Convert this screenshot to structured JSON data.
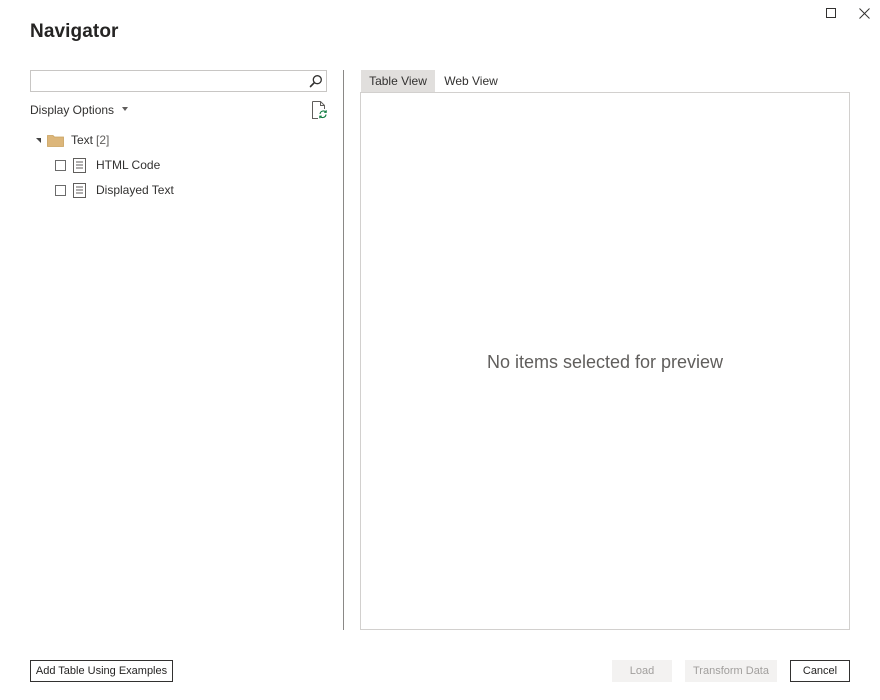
{
  "window": {
    "title": "Navigator",
    "maximize_icon": "maximize-icon",
    "close_icon": "close-icon"
  },
  "search": {
    "value": "",
    "placeholder": "",
    "icon": "search-icon"
  },
  "display_options": {
    "label": "Display Options",
    "icon": "caret-down-icon"
  },
  "refresh": {
    "icon": "refresh-document-icon"
  },
  "tree": {
    "folder": {
      "label": "Text",
      "count": "[2]",
      "expanded": true,
      "icon": "folder-icon"
    },
    "items": [
      {
        "label": "HTML Code",
        "checked": false,
        "icon": "table-icon"
      },
      {
        "label": "Displayed Text",
        "checked": false,
        "icon": "table-icon"
      }
    ]
  },
  "tabs": [
    {
      "label": "Table View",
      "active": true
    },
    {
      "label": "Web View",
      "active": false
    }
  ],
  "preview": {
    "empty_message": "No items selected for preview"
  },
  "buttons": {
    "add_table": "Add Table Using Examples",
    "load": "Load",
    "transform": "Transform Data",
    "cancel": "Cancel"
  },
  "colors": {
    "folder": "#dcb67a",
    "active_tab": "#e1dfdd",
    "disabled_button": "#f3f2f1"
  }
}
